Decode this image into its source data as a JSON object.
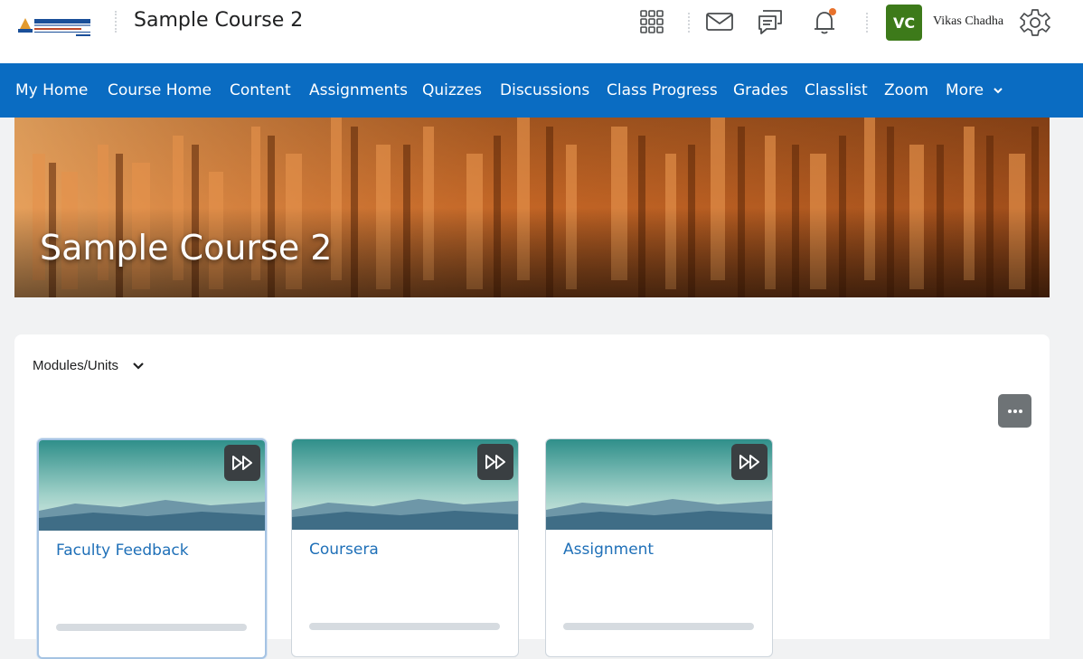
{
  "header": {
    "course_title": "Sample Course 2",
    "user_initials": "VC",
    "user_name": "Vikas Chadha",
    "icons": [
      "app-grid-icon",
      "mail-icon",
      "chat-icon",
      "bell-icon",
      "gear-icon"
    ],
    "notification_dot_color": "#e8722c",
    "avatar_color": "#3d7a1a"
  },
  "nav": {
    "color": "#0a6cc2",
    "items": [
      {
        "label": "My Home"
      },
      {
        "label": "Course Home"
      },
      {
        "label": "Content"
      },
      {
        "label": "Assignments"
      },
      {
        "label": "Quizzes"
      },
      {
        "label": "Discussions"
      },
      {
        "label": "Class Progress"
      },
      {
        "label": "Grades"
      },
      {
        "label": "Classlist"
      },
      {
        "label": "Zoom"
      },
      {
        "label": "More"
      }
    ]
  },
  "banner": {
    "title": "Sample Course 2"
  },
  "modules": {
    "selector_label": "Modules/Units",
    "cards": [
      {
        "title": "Faculty Feedback",
        "selected": true
      },
      {
        "title": "Coursera",
        "selected": false
      },
      {
        "title": "Assignment",
        "selected": false
      }
    ]
  }
}
